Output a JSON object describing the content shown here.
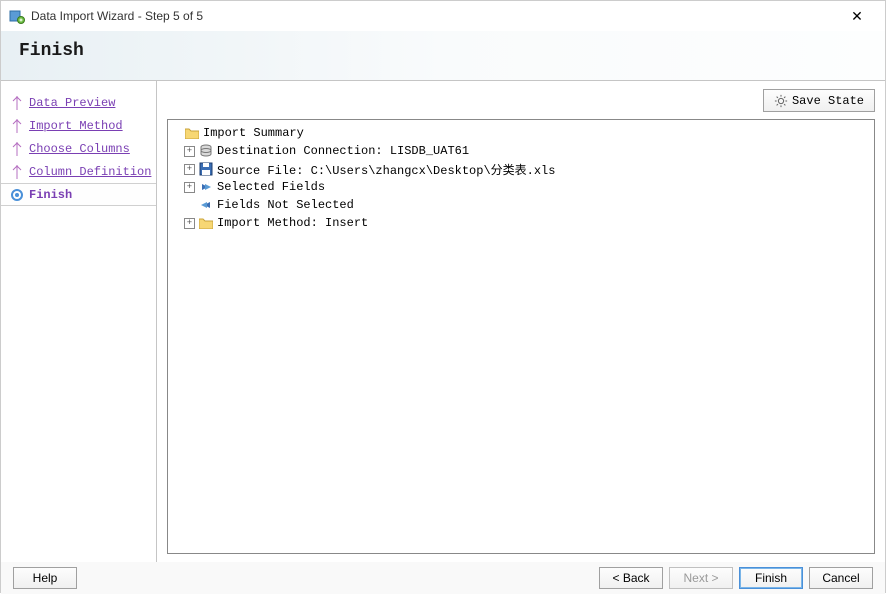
{
  "window": {
    "title": "Data Import Wizard - Step 5 of 5"
  },
  "header": {
    "title": "Finish"
  },
  "sidebar": {
    "steps": [
      {
        "label": "Data Preview"
      },
      {
        "label": "Import Method"
      },
      {
        "label": "Choose Columns"
      },
      {
        "label": "Column Definition"
      },
      {
        "label": "Finish"
      }
    ]
  },
  "toolbar": {
    "save_state_label": "Save State"
  },
  "tree": {
    "root": {
      "label": "Import Summary"
    },
    "items": [
      {
        "label": "Destination Connection: LISDB_UAT61"
      },
      {
        "label": "Source File: C:\\Users\\zhangcx\\Desktop\\分类表.xls"
      },
      {
        "label": "Selected Fields"
      },
      {
        "label": "Fields Not Selected"
      },
      {
        "label": "Import Method: Insert"
      }
    ]
  },
  "footer": {
    "help": "Help",
    "back": "< Back",
    "next": "Next >",
    "finish": "Finish",
    "cancel": "Cancel"
  }
}
